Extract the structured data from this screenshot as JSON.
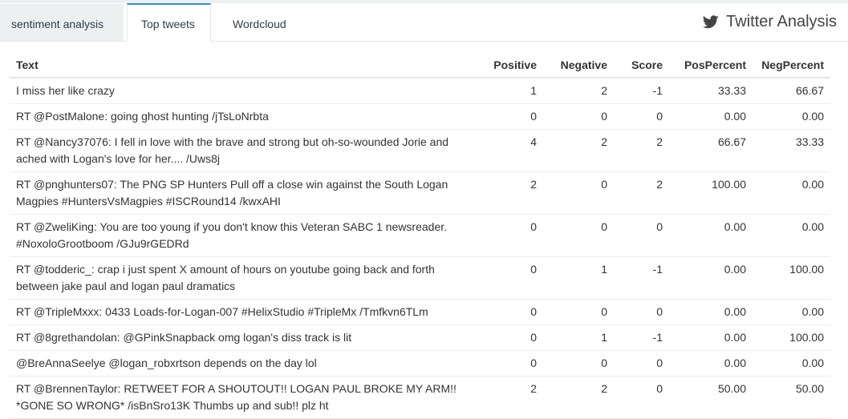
{
  "tabs": [
    {
      "label": "sentiment analysis"
    },
    {
      "label": "Top tweets"
    },
    {
      "label": "Wordcloud"
    }
  ],
  "active_tab": "Top tweets",
  "brand": {
    "title": "Twitter Analysis",
    "icon": "twitter-bird-icon"
  },
  "accent_color": "#3c8dbc",
  "table": {
    "headers": {
      "text": "Text",
      "positive": "Positive",
      "negative": "Negative",
      "score": "Score",
      "pos_percent": "PosPercent",
      "neg_percent": "NegPercent"
    },
    "rows": [
      {
        "text": "I miss her like crazy",
        "positive": "1",
        "negative": "2",
        "score": "-1",
        "pos_percent": "33.33",
        "neg_percent": "66.67"
      },
      {
        "text": "RT @PostMalone: going ghost hunting /jTsLoNrbta",
        "positive": "0",
        "negative": "0",
        "score": "0",
        "pos_percent": "0.00",
        "neg_percent": "0.00"
      },
      {
        "text": "RT @Nancy37076: I fell in love with the brave and strong but oh-so-wounded Jorie and ached with Logan's love for her.... /Uws8j",
        "positive": "4",
        "negative": "2",
        "score": "2",
        "pos_percent": "66.67",
        "neg_percent": "33.33"
      },
      {
        "text": "RT @pnghunters07: The PNG SP Hunters Pull off a close win against the South Logan Magpies #HuntersVsMagpies #ISCRound14 /kwxAHI",
        "positive": "2",
        "negative": "0",
        "score": "2",
        "pos_percent": "100.00",
        "neg_percent": "0.00"
      },
      {
        "text": "RT @ZweliKing: You are too young if you don't know this Veteran SABC 1 newsreader. #NoxoloGrootboom /GJu9rGEDRd",
        "positive": "0",
        "negative": "0",
        "score": "0",
        "pos_percent": "0.00",
        "neg_percent": "0.00"
      },
      {
        "text": "RT @todderic_: crap i just spent X amount of hours on youtube going back and forth between jake paul and logan paul dramatics",
        "positive": "0",
        "negative": "1",
        "score": "-1",
        "pos_percent": "0.00",
        "neg_percent": "100.00"
      },
      {
        "text": "RT @TripleMxxx: 0433 Loads-for-Logan-007 #HelixStudio #TripleMx /Tmfkvn6TLm",
        "positive": "0",
        "negative": "0",
        "score": "0",
        "pos_percent": "0.00",
        "neg_percent": "0.00"
      },
      {
        "text": "RT @8grethandolan: @GPinkSnapback omg logan's diss track is lit",
        "positive": "0",
        "negative": "1",
        "score": "-1",
        "pos_percent": "0.00",
        "neg_percent": "100.00"
      },
      {
        "text": "@BreAnnaSeelye @logan_robxrtson depends on the day lol",
        "positive": "0",
        "negative": "0",
        "score": "0",
        "pos_percent": "0.00",
        "neg_percent": "0.00"
      },
      {
        "text": "RT @BrennenTaylor: RETWEET FOR A SHOUTOUT!! LOGAN PAUL BROKE MY ARM!! *GONE SO WRONG* /isBnSro13K Thumbs up and sub!! plz ht",
        "positive": "2",
        "negative": "2",
        "score": "0",
        "pos_percent": "50.00",
        "neg_percent": "50.00"
      }
    ]
  }
}
